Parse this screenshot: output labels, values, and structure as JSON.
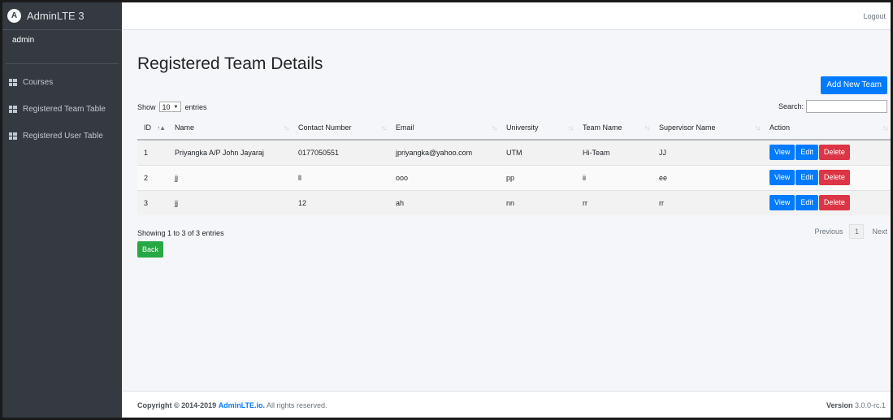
{
  "brand": {
    "logo_letter": "A",
    "name": "AdminLTE 3"
  },
  "user": {
    "name": "admin"
  },
  "sidebar": {
    "items": [
      {
        "label": "Courses",
        "icon": "table-icon"
      },
      {
        "label": "Registered Team Table",
        "icon": "table-icon"
      },
      {
        "label": "Registered User Table",
        "icon": "table-icon"
      }
    ]
  },
  "topbar": {
    "logout": "Logout"
  },
  "page": {
    "title": "Registered Team Details",
    "add_button": "Add New Team",
    "show_label": "Show",
    "entries_label": "entries",
    "length_value": "10",
    "search_label": "Search:",
    "search_value": ""
  },
  "table": {
    "columns": [
      "ID",
      "Name",
      "Contact Number",
      "Email",
      "University",
      "Team Name",
      "Supervisor Name",
      "Action"
    ],
    "rows": [
      [
        "1",
        "Priyangka A/P John Jayaraj",
        "0177050551",
        "jpriyangka@yahoo.com",
        "UTM",
        "Hi-Team",
        "JJ"
      ],
      [
        "2",
        "jj",
        "ll",
        "ooo",
        "pp",
        "ii",
        "ee"
      ],
      [
        "3",
        "jj",
        "12",
        "ah",
        "nn",
        "rr",
        "rr"
      ]
    ],
    "actions": {
      "view": "View",
      "edit": "Edit",
      "delete": "Delete"
    }
  },
  "info": "Showing 1 to 3 of 3 entries",
  "pagination": {
    "previous": "Previous",
    "current": "1",
    "next": "Next"
  },
  "back_button": "Back",
  "footer": {
    "copyright": "Copyright © 2014-2019",
    "link": "AdminLTE.io.",
    "rights": "All rights reserved.",
    "version_label": "Version",
    "version": "3.0.0-rc.1"
  }
}
